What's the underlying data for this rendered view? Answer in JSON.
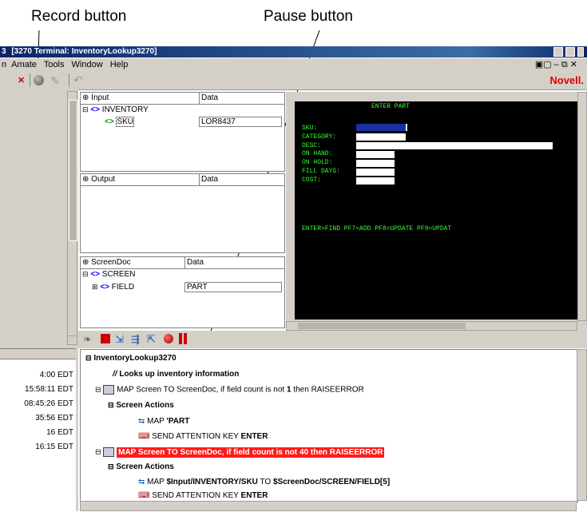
{
  "callouts": {
    "record": "Record button",
    "pause": "Pause button"
  },
  "window": {
    "title": "[3270 Terminal: InventoryLookup3270]",
    "title_prefix": "3"
  },
  "menu": {
    "items": [
      "n",
      "A",
      "mate",
      "Tools",
      "Window",
      "Help"
    ]
  },
  "brand": "Novell.",
  "input_panel": {
    "col1": "Input",
    "col2": "Data",
    "root": "INVENTORY",
    "child": "SKU",
    "child_value": "LOR8437"
  },
  "output_panel": {
    "col1": "Output",
    "col2": "Data"
  },
  "screendoc_panel": {
    "col1": "ScreenDoc",
    "col2": "Data",
    "root": "SCREEN",
    "child": "FIELD",
    "child_value": "PART"
  },
  "terminal": {
    "title": "ENTER PART",
    "labels": [
      "SKU:",
      "CATEGORY:",
      "DESC:",
      "ON HAND:",
      "ON HOLD:",
      "FILL DAYS:",
      "COST:"
    ],
    "footer": "ENTER=FIND PF7=ADD PF8=UPDATE PF9=UPDAT"
  },
  "timestamps": [
    "4:00 EDT",
    "15:58:11 EDT",
    "08:45:26 EDT",
    "35:56 EDT",
    "16 EDT",
    "16:15 EDT"
  ],
  "action_tree": {
    "root": "InventoryLookup3270",
    "comment": "Looks up inventory information",
    "map1_prefix": "MAP Screen TO ScreenDoc, if field count is not ",
    "map1_count": "1",
    "map1_suffix": " then RAISEERROR",
    "screen_actions": "Screen Actions",
    "map_part_prefix": "MAP ",
    "map_part_value": "'PART",
    "send_key_prefix": "SEND ATTENTION KEY ",
    "send_key_value": "ENTER",
    "map2": "MAP Screen TO ScreenDoc, if field count is not 40 then RAISEERROR",
    "screen_actions2": "Screen Actions",
    "map_sku_prefix": "MAP ",
    "map_sku_src": "$Input/INVENTORY/SKU",
    "map_sku_mid": " TO ",
    "map_sku_dst": "$ScreenDoc/SCREEN/FIELD[5]",
    "send_key2_prefix": "SEND ATTENTION KEY ",
    "send_key2_value": "ENTER"
  }
}
